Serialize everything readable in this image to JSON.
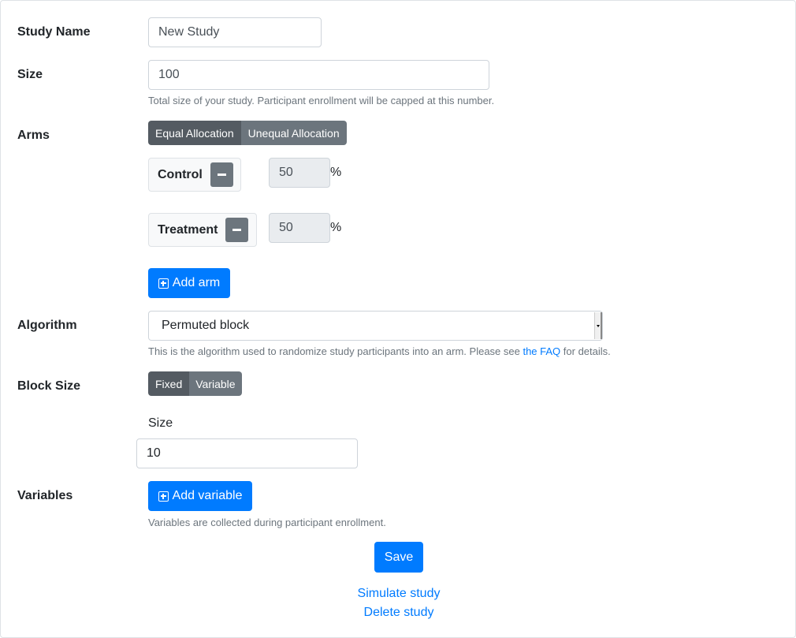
{
  "form": {
    "study_name": {
      "label": "Study Name",
      "value": "New Study"
    },
    "size": {
      "label": "Size",
      "value": "100",
      "help": "Total size of your study. Participant enrollment will be capped at this number."
    },
    "arms": {
      "label": "Arms",
      "allocation_options": [
        "Equal Allocation",
        "Unequal Allocation"
      ],
      "selected_allocation": "Equal Allocation",
      "items": [
        {
          "name": "Control",
          "percent": "50"
        },
        {
          "name": "Treatment",
          "percent": "50"
        }
      ],
      "percent_sign": "%",
      "add_label": "Add arm"
    },
    "algorithm": {
      "label": "Algorithm",
      "selected": "Permuted block",
      "help_before": "This is the algorithm used to randomize study participants into an arm. Please see ",
      "help_link": "the FAQ",
      "help_after": " for details."
    },
    "block_size": {
      "label": "Block Size",
      "options": [
        "Fixed",
        "Variable"
      ],
      "selected": "Fixed",
      "size_label": "Size",
      "size_value": "10"
    },
    "variables": {
      "label": "Variables",
      "add_label": "Add variable",
      "help": "Variables are collected during participant enrollment."
    }
  },
  "actions": {
    "save_label": "Save",
    "simulate_label": "Simulate study",
    "delete_label": "Delete study"
  },
  "colors": {
    "primary": "#007bff",
    "secondary": "#6c757d",
    "secondary_active": "#545b62"
  }
}
